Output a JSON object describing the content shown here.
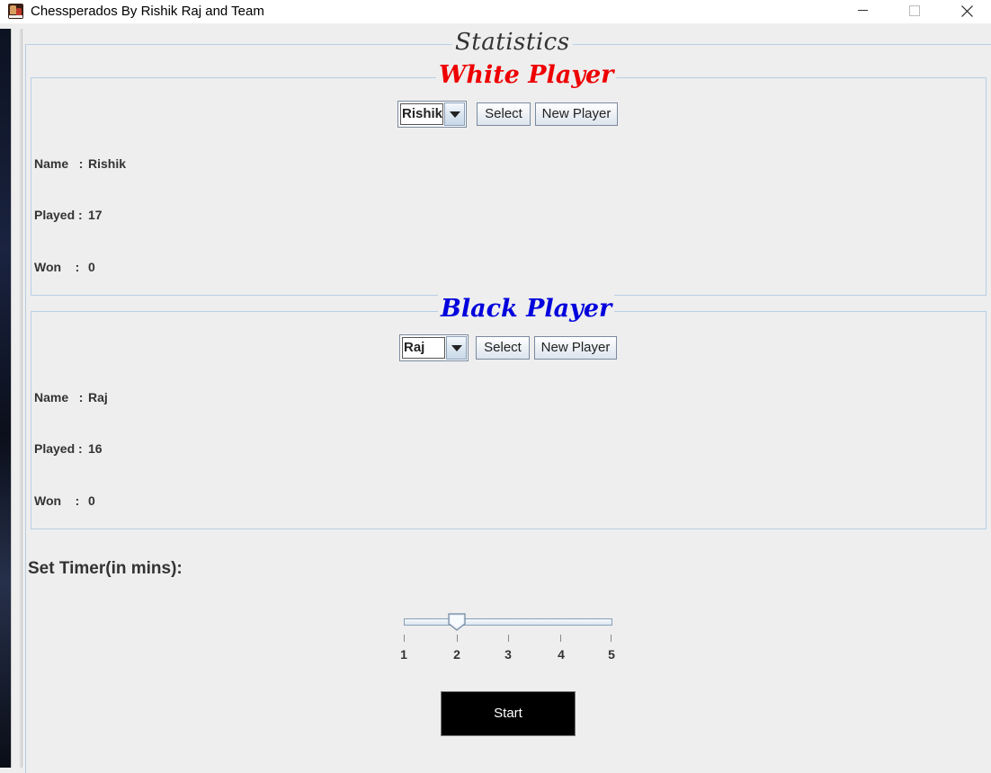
{
  "window": {
    "title": "Chessperados By Rishik Raj and Team",
    "app_icon": "chess-pieces-icon",
    "controls": [
      "minimize-icon",
      "maximize-icon",
      "close-icon"
    ]
  },
  "statistics": {
    "title": "Statistics"
  },
  "white_player": {
    "title": "White Player",
    "title_color": "#ee0000",
    "selected": "Rishik",
    "select_label": "Select",
    "new_player_label": "New Player",
    "name_label": "Name   :",
    "name_value": "Rishik",
    "played_label": "Played :",
    "played_value": "17",
    "won_label": "Won    :",
    "won_value": "0"
  },
  "black_player": {
    "title": "Black Player",
    "title_color": "#0000dd",
    "selected": "Raj",
    "select_label": "Select",
    "new_player_label": "New Player",
    "name_label": "Name   :",
    "name_value": "Raj",
    "played_label": "Played :",
    "played_value": "16",
    "won_label": "Won    :",
    "won_value": "0"
  },
  "timer": {
    "label": "Set Timer(in mins):",
    "min": 1,
    "max": 5,
    "value": 2,
    "ticks": [
      "1",
      "2",
      "3",
      "4",
      "5"
    ]
  },
  "start_label": "Start"
}
